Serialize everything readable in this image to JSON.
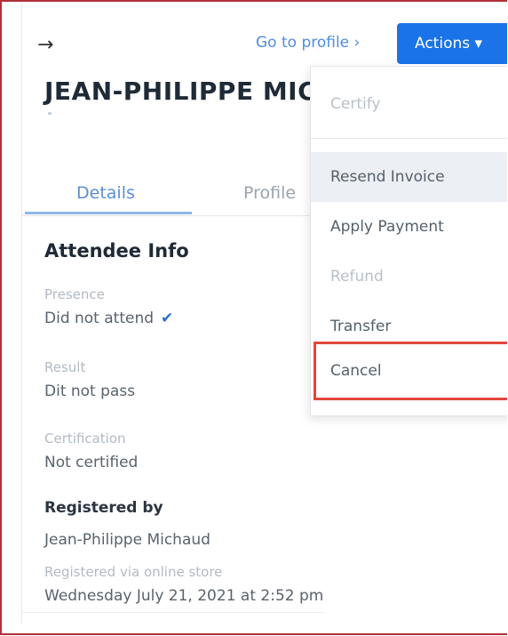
{
  "header": {
    "back_icon": "arrow-right-icon",
    "back_glyph": "→",
    "goto_profile": "Go to profile ›",
    "actions_label": "Actions ▾",
    "accent": "#1a73e8"
  },
  "attendee": {
    "name": "JEAN-PHILIPPE MIC"
  },
  "tabs": [
    {
      "label": "Details",
      "active": true
    },
    {
      "label": "Profile",
      "active": false
    }
  ],
  "info": {
    "title": "Attendee Info",
    "presence_label": "Presence",
    "presence_value": "Did not attend",
    "edit_glyph": "✔",
    "result_label": "Result",
    "result_value": "Dit not pass",
    "certification_label": "Certification",
    "certification_value": "Not certified",
    "registered_by_label": "Registered by",
    "registered_by_value": "Jean-Philippe Michaud",
    "registered_via_label": "Registered via online store",
    "registered_date": "Wednesday July 21, 2021 at 2:52 pm"
  },
  "menu": {
    "items": [
      {
        "label": "Certify",
        "enabled": false
      },
      {
        "label": "Resend Invoice",
        "enabled": true,
        "hovered": true
      },
      {
        "label": "Apply Payment",
        "enabled": true
      },
      {
        "label": "Refund",
        "enabled": false
      },
      {
        "label": "Transfer",
        "enabled": true
      },
      {
        "label": "Cancel",
        "enabled": true,
        "highlighted": true
      }
    ],
    "highlight_color": "#e2463c"
  }
}
